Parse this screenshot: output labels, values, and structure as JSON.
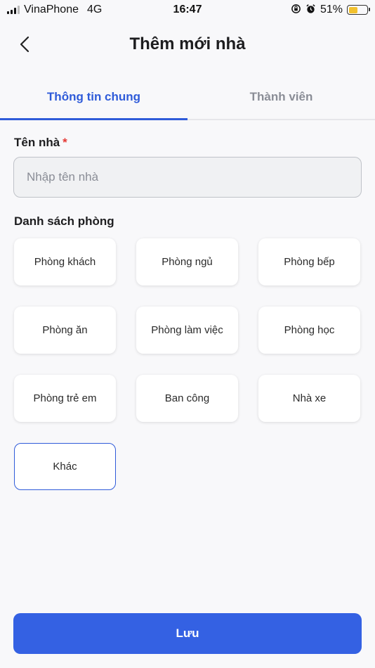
{
  "status_bar": {
    "carrier": "VinaPhone",
    "network": "4G",
    "time": "16:47",
    "battery_percent": "51%",
    "battery_level": 0.51
  },
  "header": {
    "title": "Thêm mới nhà"
  },
  "tabs": [
    {
      "label": "Thông tin chung",
      "active": true
    },
    {
      "label": "Thành viên",
      "active": false
    }
  ],
  "form": {
    "house_name_label": "Tên nhà",
    "required_mark": "*",
    "house_name_placeholder": "Nhập tên nhà",
    "house_name_value": "",
    "rooms_label": "Danh sách phòng",
    "rooms": [
      {
        "label": "Phòng khách",
        "selected": false
      },
      {
        "label": "Phòng ngủ",
        "selected": false
      },
      {
        "label": "Phòng bếp",
        "selected": false
      },
      {
        "label": "Phòng ăn",
        "selected": false
      },
      {
        "label": "Phòng làm việc",
        "selected": false
      },
      {
        "label": "Phòng học",
        "selected": false
      },
      {
        "label": "Phòng trẻ em",
        "selected": false
      },
      {
        "label": "Ban công",
        "selected": false
      },
      {
        "label": "Nhà xe",
        "selected": false
      },
      {
        "label": "Khác",
        "selected": true
      }
    ]
  },
  "actions": {
    "save_label": "Lưu"
  },
  "colors": {
    "accent": "#2F5BD9",
    "button": "#3461E3",
    "required": "#E53935",
    "battery": "#F2C12E"
  }
}
